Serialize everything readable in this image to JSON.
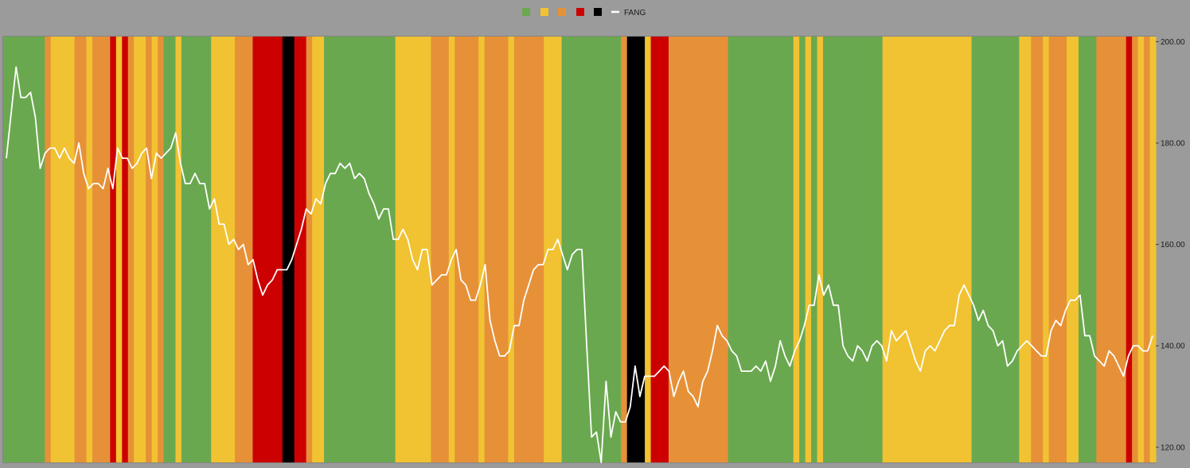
{
  "chart_data": {
    "type": "line",
    "title": "",
    "xlabel": "",
    "ylabel": "",
    "ylim": [
      117,
      201
    ],
    "y_ticks": [
      "200.00",
      "180.00",
      "160.00",
      "140.00",
      "120.00"
    ],
    "y_tick_values": [
      200,
      180,
      160,
      140,
      120
    ],
    "y_axis_side": "right",
    "grid": false,
    "legend_position": "top-center",
    "colors": {
      "green": "#6aa84f",
      "yellow": "#f1c232",
      "orange": "#e69138",
      "red": "#cc0000",
      "black": "#000000",
      "line": "#ffffff",
      "background": "#9b9b9b"
    },
    "legend": [
      {
        "color": "green",
        "label": ""
      },
      {
        "color": "yellow",
        "label": ""
      },
      {
        "color": "orange",
        "label": ""
      },
      {
        "color": "red",
        "label": ""
      },
      {
        "color": "black",
        "label": ""
      },
      {
        "color": "line",
        "label": "FANG",
        "kind": "line"
      }
    ],
    "regime_bands": [
      "green",
      "green",
      "green",
      "green",
      "green",
      "green",
      "green",
      "orange",
      "yellow",
      "yellow",
      "yellow",
      "yellow",
      "orange",
      "orange",
      "yellow",
      "orange",
      "orange",
      "orange",
      "red",
      "yellow",
      "red",
      "orange",
      "yellow",
      "yellow",
      "orange",
      "yellow",
      "orange",
      "green",
      "green",
      "yellow",
      "green",
      "green",
      "green",
      "green",
      "green",
      "yellow",
      "yellow",
      "yellow",
      "yellow",
      "orange",
      "orange",
      "orange",
      "red",
      "red",
      "red",
      "red",
      "red",
      "black",
      "black",
      "red",
      "red",
      "orange",
      "yellow",
      "yellow",
      "green",
      "green",
      "green",
      "green",
      "green",
      "green",
      "green",
      "green",
      "green",
      "green",
      "green",
      "green",
      "yellow",
      "yellow",
      "yellow",
      "yellow",
      "yellow",
      "yellow",
      "orange",
      "orange",
      "orange",
      "yellow",
      "orange",
      "orange",
      "orange",
      "orange",
      "yellow",
      "orange",
      "orange",
      "orange",
      "orange",
      "yellow",
      "orange",
      "orange",
      "orange",
      "orange",
      "orange",
      "yellow",
      "yellow",
      "yellow",
      "green",
      "green",
      "green",
      "green",
      "green",
      "green",
      "green",
      "green",
      "green",
      "green",
      "orange",
      "black",
      "black",
      "black",
      "yellow",
      "red",
      "red",
      "red",
      "orange",
      "orange",
      "orange",
      "orange",
      "orange",
      "orange",
      "orange",
      "orange",
      "orange",
      "orange",
      "green",
      "green",
      "green",
      "green",
      "green",
      "green",
      "green",
      "green",
      "green",
      "green",
      "green",
      "yellow",
      "green",
      "yellow",
      "green",
      "yellow",
      "green",
      "green",
      "green",
      "green",
      "green",
      "green",
      "green",
      "green",
      "green",
      "green",
      "yellow",
      "yellow",
      "yellow",
      "yellow",
      "yellow",
      "yellow",
      "yellow",
      "yellow",
      "yellow",
      "yellow",
      "yellow",
      "yellow",
      "yellow",
      "yellow",
      "yellow",
      "green",
      "green",
      "green",
      "green",
      "green",
      "green",
      "green",
      "green",
      "yellow",
      "yellow",
      "orange",
      "orange",
      "yellow",
      "orange",
      "orange",
      "orange",
      "yellow",
      "yellow",
      "green",
      "green",
      "green",
      "orange",
      "orange",
      "orange",
      "orange",
      "orange",
      "red",
      "orange",
      "yellow",
      "orange",
      "yellow"
    ],
    "series": [
      {
        "name": "FANG",
        "values": [
          177,
          186,
          195,
          189,
          189,
          190,
          185,
          175,
          178,
          179,
          179,
          177,
          179,
          177,
          176,
          180,
          174,
          171,
          172,
          172,
          171,
          175,
          171,
          179,
          177,
          177,
          175,
          176,
          178,
          179,
          173,
          178,
          177,
          178,
          179,
          182,
          176,
          172,
          172,
          174,
          172,
          172,
          167,
          169,
          164,
          164,
          160,
          161,
          159,
          160,
          156,
          157,
          153,
          150,
          152,
          153,
          155,
          155,
          155,
          157,
          160,
          163,
          167,
          166,
          169,
          168,
          172,
          174,
          174,
          176,
          175,
          176,
          173,
          174,
          173,
          170,
          168,
          165,
          167,
          167,
          161,
          161,
          163,
          161,
          157,
          155,
          159,
          159,
          152,
          153,
          154,
          154,
          157,
          159,
          153,
          152,
          149,
          149,
          152,
          156,
          145,
          141,
          138,
          138,
          139,
          144,
          144,
          149,
          152,
          155,
          156,
          156,
          159,
          159,
          161,
          158,
          155,
          158,
          159,
          159,
          140,
          122,
          123,
          117,
          133,
          122,
          127,
          125,
          125,
          128,
          136,
          130,
          134,
          134,
          134,
          135,
          136,
          135,
          130,
          133,
          135,
          131,
          130,
          128,
          133,
          135,
          139,
          144,
          142,
          141,
          139,
          138,
          135,
          135,
          135,
          136,
          135,
          137,
          133,
          136,
          141,
          138,
          136,
          139,
          141,
          144,
          148,
          148,
          154,
          150,
          152,
          148,
          148,
          140,
          138,
          137,
          140,
          139,
          137,
          140,
          141,
          140,
          137,
          143,
          141,
          142,
          143,
          140,
          137,
          135,
          139,
          140,
          139,
          141,
          143,
          144,
          144,
          150,
          152,
          150,
          148,
          145,
          147,
          144,
          143,
          140,
          141,
          136,
          137,
          139,
          140,
          141,
          140,
          139,
          138,
          138,
          143,
          145,
          144,
          147,
          149,
          149,
          150,
          142,
          142,
          138,
          137,
          136,
          139,
          138,
          136,
          134,
          138,
          140,
          140,
          139,
          139,
          142
        ]
      }
    ]
  }
}
